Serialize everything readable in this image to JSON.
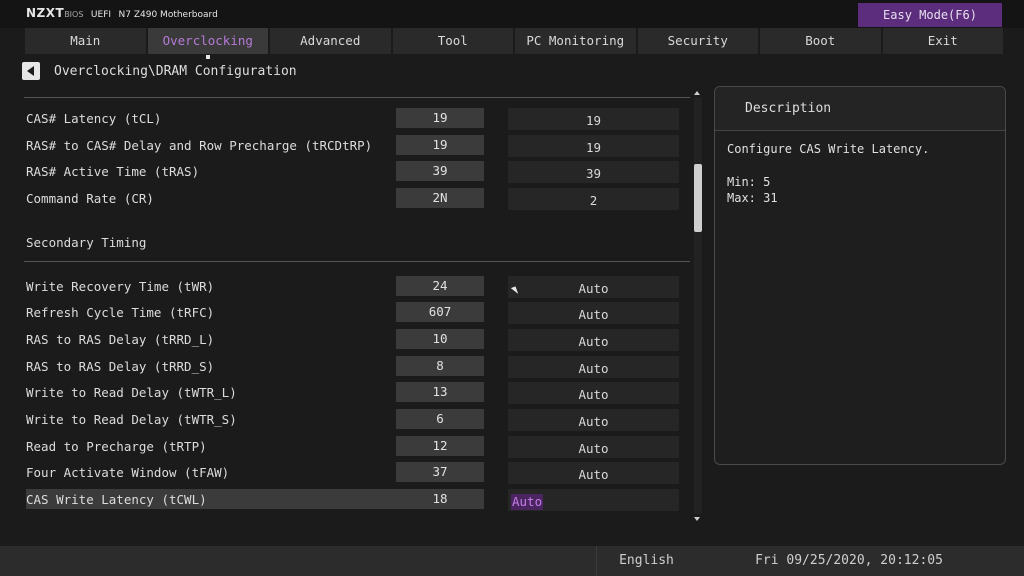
{
  "header": {
    "brand": "NZXT",
    "bios_label": "BIOS",
    "uefi_label": "UEFI",
    "model": "N7 Z490 Motherboard",
    "easy_mode_button": "Easy Mode(F6)"
  },
  "tabs": [
    {
      "label": "Main"
    },
    {
      "label": "Overclocking",
      "active": true
    },
    {
      "label": "Advanced"
    },
    {
      "label": "Tool"
    },
    {
      "label": "PC Monitoring"
    },
    {
      "label": "Security"
    },
    {
      "label": "Boot"
    },
    {
      "label": "Exit"
    }
  ],
  "breadcrumb": "Overclocking\\DRAM Configuration",
  "primary_rows": [
    {
      "label": "CAS# Latency (tCL)",
      "current": "19",
      "setting": "19"
    },
    {
      "label": "RAS# to CAS# Delay and Row Precharge (tRCDtRP)",
      "current": "19",
      "setting": "19"
    },
    {
      "label": "RAS# Active Time (tRAS)",
      "current": "39",
      "setting": "39"
    },
    {
      "label": "Command Rate (CR)",
      "current": "2N",
      "setting": "2"
    }
  ],
  "secondary_title": "Secondary Timing",
  "secondary_rows": [
    {
      "label": "Write Recovery Time (tWR)",
      "current": "24",
      "setting": "Auto"
    },
    {
      "label": "Refresh Cycle Time (tRFC)",
      "current": "607",
      "setting": "Auto"
    },
    {
      "label": "RAS to RAS Delay (tRRD_L)",
      "current": "10",
      "setting": "Auto"
    },
    {
      "label": "RAS to RAS Delay (tRRD_S)",
      "current": "8",
      "setting": "Auto"
    },
    {
      "label": "Write to Read Delay (tWTR_L)",
      "current": "13",
      "setting": "Auto"
    },
    {
      "label": "Write to Read Delay (tWTR_S)",
      "current": "6",
      "setting": "Auto"
    },
    {
      "label": "Read to Precharge (tRTP)",
      "current": "12",
      "setting": "Auto"
    },
    {
      "label": "Four Activate Window (tFAW)",
      "current": "37",
      "setting": "Auto"
    },
    {
      "label": "CAS Write Latency (tCWL)",
      "current": "18",
      "setting": "Auto",
      "selected": true
    }
  ],
  "description": {
    "title": "Description",
    "text": "Configure CAS Write Latency.",
    "min": "Min: 5",
    "max": "Max: 31"
  },
  "footer": {
    "language": "English",
    "datetime": "Fri 09/25/2020, 20:12:05"
  },
  "colors": {
    "accent": "#b57ad6",
    "easy_mode_bg": "#5b2d7c",
    "background": "#1b1b1b"
  }
}
